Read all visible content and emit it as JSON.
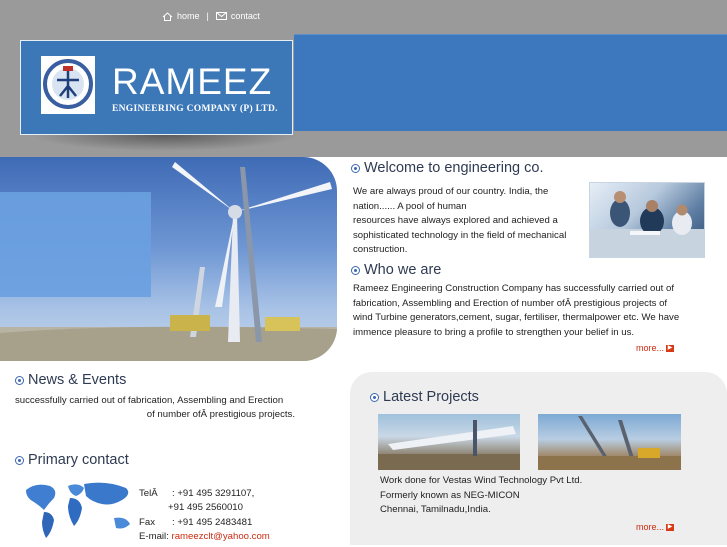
{
  "nav": {
    "home": "home",
    "separator": "|",
    "contact": "contact"
  },
  "brand": {
    "name": "RAMEEZ",
    "subtitle": "ENGINEERING COMPANY (P) LTD."
  },
  "welcome": {
    "heading": "Welcome to engineering co.",
    "lines": [
      "We are always proud of our country. India, the",
      "nation...... A pool of human",
      "resources have always explored and achieved a",
      "sophisticated technology in the field of mechanical",
      "construction."
    ]
  },
  "who": {
    "heading": "Who we are",
    "lines": [
      "Rameez Engineering Construction Company has successfully carried out of",
      "fabrication, Assembling and Erection of number ofÂ prestigious projects of",
      "wind Turbine generators,cement, sugar, fertiliser, thermalpower etc.  We have",
      "immence pleasure to bring a profile to strengthen your belief in us."
    ],
    "more": "more..."
  },
  "news": {
    "heading": "News & Events",
    "line1": "successfully carried out of fabrication, Assembling and Erection",
    "line2": "of number ofÂ prestigious projects."
  },
  "contact": {
    "heading": "Primary  contact",
    "tel_label": "TelÂ",
    "tel1": ": +91 495 3291107,",
    "tel2": "+91 495 2560010",
    "fax_label": "Fax",
    "fax": ": +91 495 2483481",
    "email_label": "E-mail",
    "email": "rameezclt@yahoo.com"
  },
  "projects": {
    "heading": "Latest Projects",
    "lines": [
      "Work done for Vestas Wind Technology Pvt Ltd.",
      "Formerly known as NEG-MICON",
      "Chennai, Tamilnadu,India."
    ],
    "more": "more..."
  },
  "colors": {
    "header_gray": "#9a9a9b",
    "brand_blue": "#3d78bf",
    "link_red": "#cc2a12",
    "panel_gray": "#eeeeee"
  }
}
